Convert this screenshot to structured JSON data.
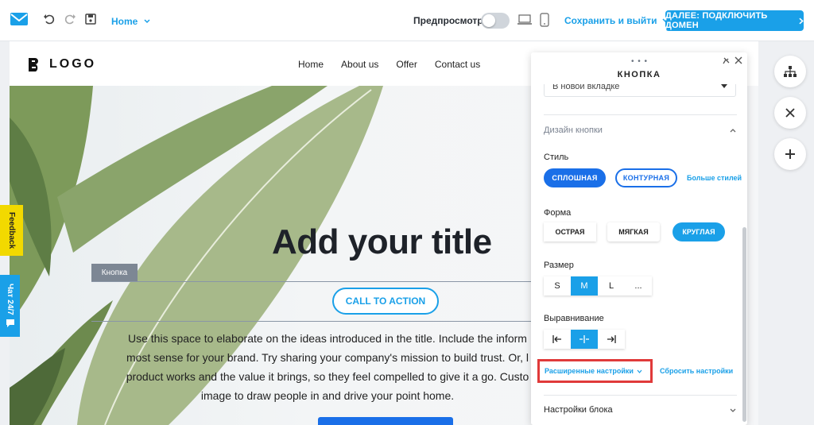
{
  "toolbar": {
    "page_select": "Home",
    "preview_label": "Предпросмотр",
    "save_exit": "Сохранить и выйти",
    "next_button": "ДАЛЕЕ: ПОДКЛЮЧИТЬ ДОМЕН",
    "accent_color": "#1aa0e8"
  },
  "site": {
    "logo_text": "LOGO",
    "nav": [
      "Home",
      "About us",
      "Offer",
      "Contact us"
    ],
    "hero_title": "Add your title",
    "element_hint": "Кнопка",
    "cta_label": "CALL TO ACTION",
    "hero_text": "Use this space to elaborate on the ideas introduced in the title. Include the inform most sense for your brand. Try sharing your company's mission to build trust. Or, l product works and the value it brings, so they feel compelled to give it a go. Custo image to draw people in and drive your point home."
  },
  "side_tabs": {
    "feedback": "Feedback",
    "chat": "Чат 24/7"
  },
  "panel": {
    "title": "КНОПКА",
    "open_in": "В новой вкладке",
    "design_section": "Дизайн кнопки",
    "style_label": "Стиль",
    "style_solid": "СПЛОШНАЯ",
    "style_outline": "КОНТУРНАЯ",
    "style_more": "Больше стилей",
    "shape_label": "Форма",
    "shape_sharp": "ОСТРАЯ",
    "shape_soft": "МЯГКАЯ",
    "shape_round": "КРУГЛАЯ",
    "size_label": "Размер",
    "sizes": [
      "S",
      "M",
      "L",
      "..."
    ],
    "align_label": "Выравнивание",
    "advanced": "Расширенные настройки",
    "reset": "Сбросить настройки",
    "block_settings": "Настройки блока",
    "highlight_color": "#e03a3a"
  }
}
